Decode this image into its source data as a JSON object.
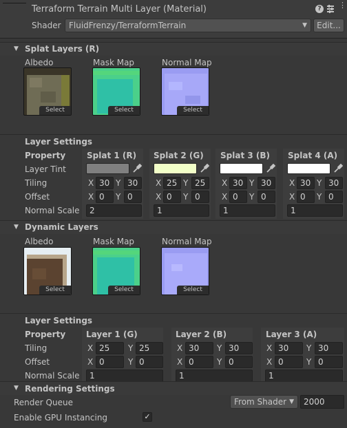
{
  "header": {
    "title": "Terraform Terrain Multi Layer (Material)",
    "shader_label": "Shader",
    "shader_value": "FluidFrenzy/TerraformTerrain",
    "edit_label": "Edit..."
  },
  "splat": {
    "title": "Splat Layers (R)",
    "textures": [
      {
        "label": "Albedo",
        "select": "Select"
      },
      {
        "label": "Mask Map",
        "select": "Select"
      },
      {
        "label": "Normal Map",
        "select": "Select"
      }
    ],
    "settings_title": "Layer Settings",
    "property_label": "Property",
    "columns": [
      "Splat 1 (R)",
      "Splat 2 (G)",
      "Splat 3 (B)",
      "Splat 4 (A)"
    ],
    "tint_label": "Layer Tint",
    "tint_colors": [
      "#808080",
      "#f2ffc8",
      "#ffffff",
      "#ffffff"
    ],
    "tiling_label": "Tiling",
    "tiling": [
      [
        "30",
        "30"
      ],
      [
        "25",
        "25"
      ],
      [
        "30",
        "30"
      ],
      [
        "30",
        "30"
      ]
    ],
    "offset_label": "Offset",
    "offset": [
      [
        "0",
        "0"
      ],
      [
        "0",
        "0"
      ],
      [
        "0",
        "0"
      ],
      [
        "0",
        "0"
      ]
    ],
    "normal_label": "Normal Scale",
    "normal": [
      "2",
      "1",
      "1",
      "1"
    ]
  },
  "dynamic": {
    "title": "Dynamic Layers",
    "textures": [
      {
        "label": "Albedo",
        "select": "Select"
      },
      {
        "label": "Mask Map",
        "select": "Select"
      },
      {
        "label": "Normal Map",
        "select": "Select"
      }
    ],
    "settings_title": "Layer Settings",
    "property_label": "Property",
    "columns": [
      "Layer 1 (G)",
      "Layer 2 (B)",
      "Layer 3 (A)"
    ],
    "tiling_label": "Tiling",
    "tiling": [
      [
        "25",
        "25"
      ],
      [
        "30",
        "30"
      ],
      [
        "30",
        "30"
      ]
    ],
    "offset_label": "Offset",
    "offset": [
      [
        "0",
        "0"
      ],
      [
        "0",
        "0"
      ],
      [
        "0",
        "0"
      ]
    ],
    "normal_label": "Normal Scale",
    "normal": [
      "1",
      "1",
      "1"
    ]
  },
  "axes": {
    "x": "X",
    "y": "Y"
  },
  "rendering": {
    "title": "Rendering Settings",
    "queue_label": "Render Queue",
    "queue_mode": "From Shader",
    "queue_value": "2000",
    "gpu_label": "Enable GPU Instancing",
    "gpu_checked": "✓"
  }
}
